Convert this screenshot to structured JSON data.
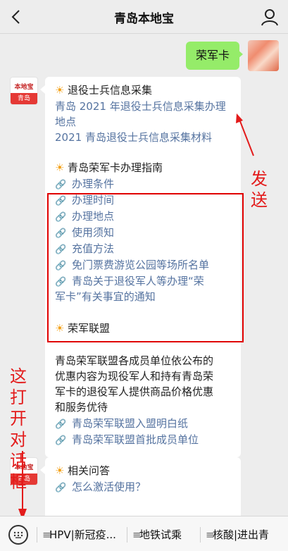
{
  "header": {
    "title": "青岛本地宝"
  },
  "sent": {
    "text": "荣军卡"
  },
  "logo": {
    "top": "本地宝",
    "bottom": "青岛"
  },
  "bubble1": {
    "section1_title": "退役士兵信息采集",
    "section1_links": [
      "青岛 2021 年退役士兵信息采集办理",
      "地点",
      "2021 青岛退役士兵信息采集材料"
    ],
    "section2_title": "青岛荣军卡办理指南",
    "section2_links": [
      "办理条件",
      "办理时间",
      "办理地点",
      "使用须知",
      "充值方法",
      "免门票费游览公园等场所名单",
      "青岛关于退役军人等办理“荣",
      "军卡”有关事宜的通知"
    ],
    "section3_title": "荣军联盟",
    "section3_body": [
      "青岛荣军联盟各成员单位依公布的",
      "优惠内容为现役军人和持有青岛荣",
      "军卡的退役军人提供商品价格优惠",
      "和服务优待"
    ],
    "section3_links": [
      "青岛荣军联盟入盟明白纸",
      "青岛荣军联盟首批成员单位"
    ]
  },
  "bubble2": {
    "title": "相关问答",
    "links": [
      "怎么激活使用？"
    ]
  },
  "annotations": {
    "send": "发送",
    "open": "这打开对话框"
  },
  "bottom_menu": [
    "HPV|新冠疫...",
    "地铁试乘",
    "核酸|进出青"
  ],
  "colors": {
    "sent_bubble": "#95ec69",
    "link": "#5573a0",
    "annotation": "#e31b1b"
  }
}
